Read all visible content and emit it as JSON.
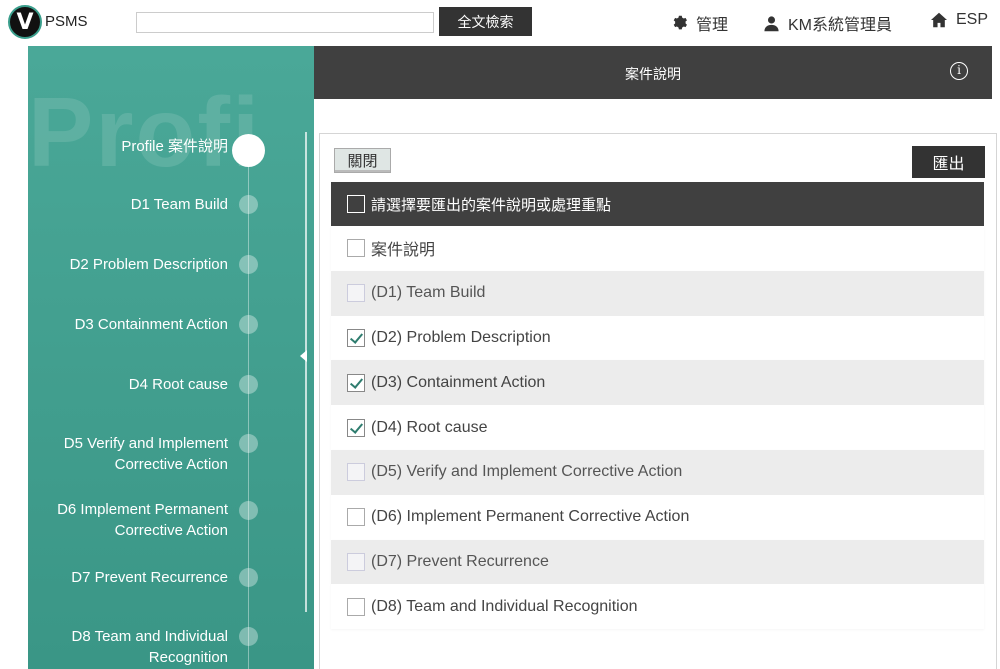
{
  "app": {
    "logo_letter": "V",
    "brand": "PSMS"
  },
  "search": {
    "placeholder": "",
    "button_label": "全文檢索"
  },
  "nav": {
    "manage_label": "管理",
    "user_label": "KM系統管理員",
    "home_label": "ESP"
  },
  "sidebar": {
    "ghost_text": "Profi",
    "steps": [
      {
        "label": "Profile 案件說明",
        "active": true
      },
      {
        "label": "D1 Team Build"
      },
      {
        "label": "D2 Problem Description"
      },
      {
        "label": "D3 Containment Action"
      },
      {
        "label": "D4 Root cause"
      },
      {
        "label_line1": "D5 Verify and Implement",
        "label_line2": "Corrective Action"
      },
      {
        "label_line1": "D6 Implement Permanent",
        "label_line2": "Corrective Action"
      },
      {
        "label": "D7 Prevent Recurrence"
      },
      {
        "label_line1": "D8 Team and Individual",
        "label_line2": "Recognition"
      }
    ]
  },
  "main": {
    "title": "案件說明",
    "info_glyph": "i",
    "close_label": "關閉",
    "export_label": "匯出",
    "select_all_label": "請選擇要匯出的案件說明或處理重點",
    "options": [
      {
        "label": "案件說明",
        "checked": false,
        "disabled": false
      },
      {
        "label": "(D1) Team Build",
        "checked": false,
        "disabled": true
      },
      {
        "label": "(D2) Problem Description",
        "checked": true,
        "disabled": false
      },
      {
        "label": "(D3) Containment Action",
        "checked": true,
        "disabled": false
      },
      {
        "label": "(D4) Root cause",
        "checked": true,
        "disabled": false
      },
      {
        "label": "(D5) Verify and Implement Corrective Action",
        "checked": false,
        "disabled": true
      },
      {
        "label": "(D6) Implement Permanent Corrective Action",
        "checked": false,
        "disabled": false
      },
      {
        "label": "(D7) Prevent Recurrence",
        "checked": false,
        "disabled": true
      },
      {
        "label": "(D8) Team and Individual Recognition",
        "checked": false,
        "disabled": false
      }
    ]
  },
  "colors": {
    "teal": "#3f9e8e",
    "dark": "#404040",
    "check": "#2f7d6f"
  }
}
